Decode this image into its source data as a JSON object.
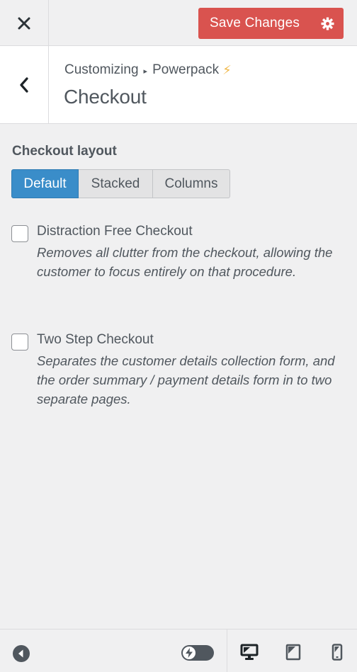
{
  "header": {
    "save_label": "Save Changes"
  },
  "section": {
    "breadcrumb_root": "Customizing",
    "breadcrumb_sep": "▸",
    "breadcrumb_parent": "Powerpack",
    "breadcrumb_icon": "⚡",
    "title": "Checkout"
  },
  "layout": {
    "label": "Checkout layout",
    "options": [
      "Default",
      "Stacked",
      "Columns"
    ],
    "selected": "Default"
  },
  "options": [
    {
      "title": "Distraction Free Checkout",
      "description": "Removes all clutter from the checkout, allowing the customer to focus entirely on that procedure.",
      "checked": false
    },
    {
      "title": "Two Step Checkout",
      "description": "Separates the customer details collection form, and the order summary / payment details form in to two separate pages.",
      "checked": false
    }
  ],
  "footer": {
    "icons": [
      "collapse-icon",
      "toggle-icon",
      "desktop-icon",
      "tablet-icon",
      "mobile-icon"
    ],
    "active_device": "desktop"
  },
  "colors": {
    "save_button": "#d9534f",
    "active_segment": "#3a8dc9",
    "bolt": "#f0b849"
  }
}
